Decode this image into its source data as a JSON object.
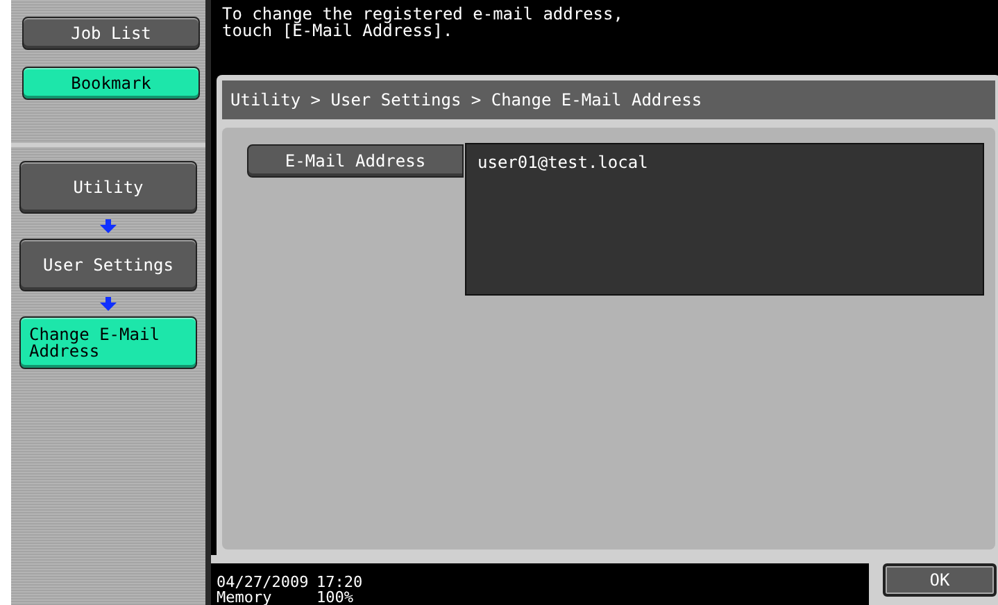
{
  "top_buttons": [
    {
      "label": "Job List",
      "selected": false
    },
    {
      "label": "Bookmark",
      "selected": true
    }
  ],
  "path_steps": [
    {
      "label": "Utility",
      "selected": false
    },
    {
      "label": "User Settings",
      "selected": false
    },
    {
      "label": "Change E-Mail Address",
      "selected": true
    }
  ],
  "message": [
    "To change the registered e-mail address,",
    "touch [E-Mail Address]."
  ],
  "breadcrumb": "Utility > User Settings > Change E-Mail Address",
  "field": {
    "label": "E-Mail Address",
    "value": "user01@test.local"
  },
  "status": {
    "date": "04/27/2009",
    "time": "17:20",
    "memory_label": "Memory",
    "memory_value": "100%"
  },
  "ok_button": "OK"
}
